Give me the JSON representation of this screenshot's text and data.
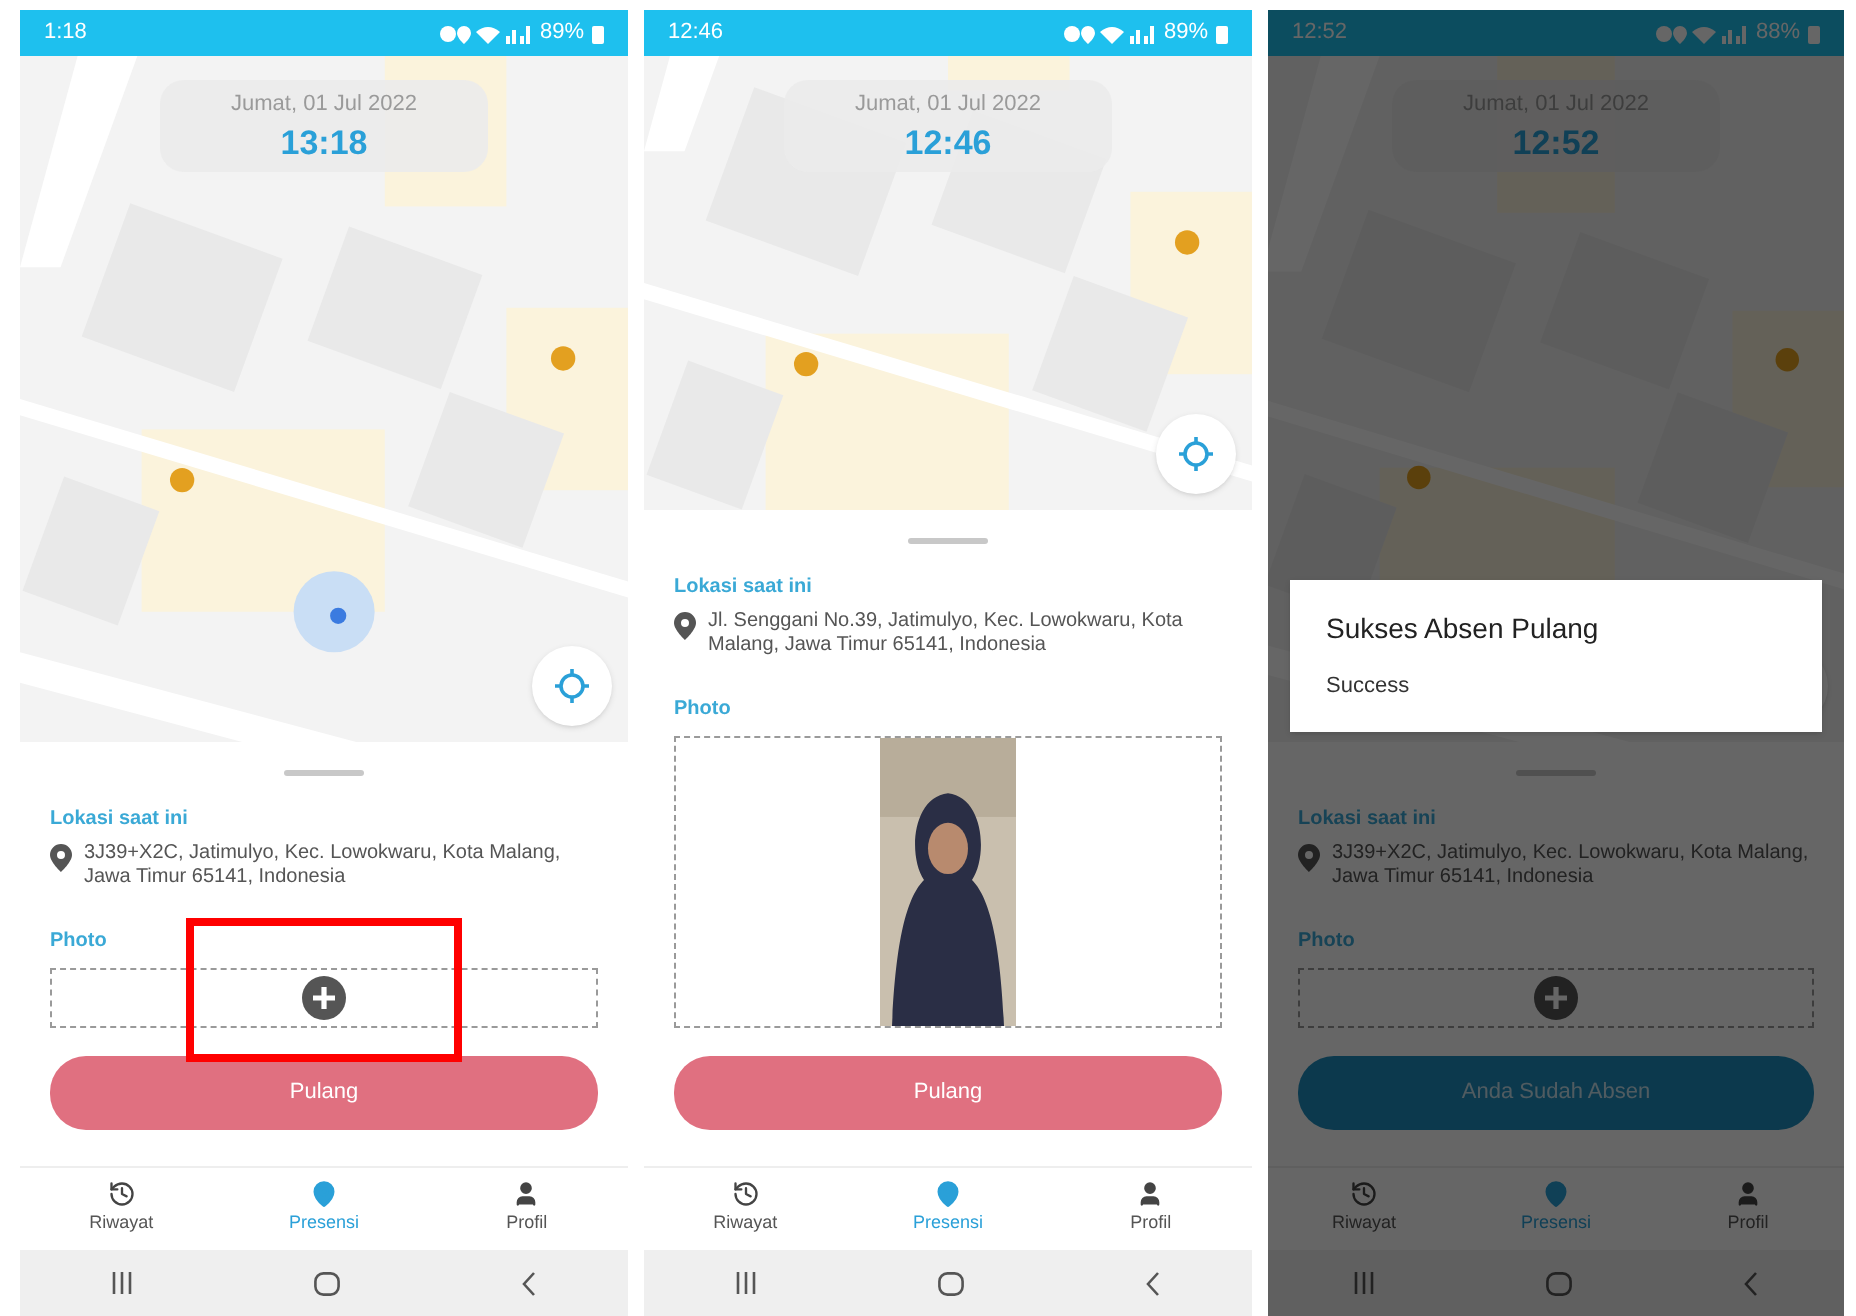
{
  "phones": [
    {
      "status_bar": {
        "time": "1:18",
        "battery": "89%"
      },
      "clock": {
        "date": "Jumat, 01 Jul 2022",
        "time": "13:18"
      },
      "location_label": "Lokasi saat ini",
      "address": "3J39+X2C, Jatimulyo, Kec. Lowokwaru, Kota Malang, Jawa Timur 65141, Indonesia",
      "photo_label": "Photo",
      "photo": {
        "kind": "empty",
        "highlighted": true
      },
      "button": {
        "label": "Pulang",
        "disabled": false
      },
      "nav": [
        {
          "label": "Riwayat",
          "selected": false
        },
        {
          "label": "Presensi",
          "selected": true
        },
        {
          "label": "Profil",
          "selected": false
        }
      ]
    },
    {
      "status_bar": {
        "time": "12:46",
        "battery": "89%"
      },
      "clock": {
        "date": "Jumat, 01 Jul 2022",
        "time": "12:46"
      },
      "location_label": "Lokasi saat ini",
      "address": "Jl. Senggani No.39, Jatimulyo, Kec. Lowokwaru, Kota Malang, Jawa Timur 65141, Indonesia",
      "photo_label": "Photo",
      "button": {
        "label": "Pulang",
        "disabled": false
      },
      "nav": [
        {
          "label": "Riwayat",
          "selected": false
        },
        {
          "label": "Presensi",
          "selected": true
        },
        {
          "label": "Profil",
          "selected": false
        }
      ]
    },
    {
      "status_bar": {
        "time": "12:52",
        "battery": "88%"
      },
      "clock": {
        "date": "Jumat, 01 Jul 2022",
        "time": "12:52"
      },
      "location_label": "Lokasi saat ini",
      "address": "3J39+X2C, Jatimulyo, Kec. Lowokwaru, Kota Malang, Jawa Timur 65141, Indonesia",
      "photo_label": "Photo",
      "photo": {
        "kind": "empty",
        "highlighted": false
      },
      "button": {
        "label": "Anda Sudah Absen",
        "disabled": true
      },
      "nav": [
        {
          "label": "Riwayat",
          "selected": false
        },
        {
          "label": "Presensi",
          "selected": true
        },
        {
          "label": "Profil",
          "selected": false
        }
      ],
      "dialog": {
        "title": "Sukses Absen Pulang",
        "message": "Success"
      }
    }
  ]
}
